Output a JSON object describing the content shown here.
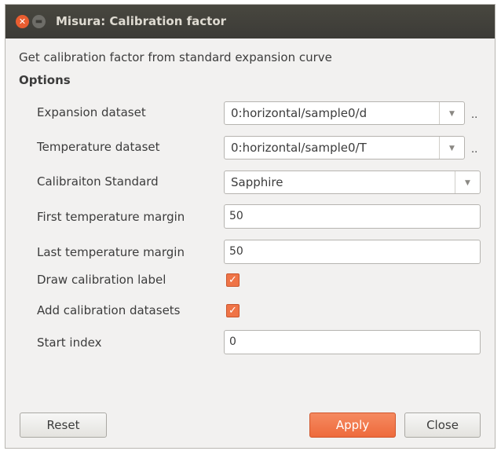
{
  "window": {
    "title": "Misura: Calibration factor"
  },
  "header": {
    "description": "Get calibration factor from standard expansion curve",
    "section": "Options"
  },
  "fields": {
    "expansion": {
      "label": "Expansion dataset",
      "value": "0:horizontal/sample0/d",
      "extra": ".."
    },
    "temperature": {
      "label": "Temperature dataset",
      "value": "0:horizontal/sample0/T",
      "extra": ".."
    },
    "standard": {
      "label": "Calibraiton Standard",
      "value": "Sapphire"
    },
    "first_margin": {
      "label": "First temperature margin",
      "value": "50"
    },
    "last_margin": {
      "label": "Last temperature margin",
      "value": "50"
    },
    "draw_label": {
      "label": "Draw calibration label",
      "checked": true
    },
    "add_datasets": {
      "label": "Add calibration datasets",
      "checked": true
    },
    "start_index": {
      "label": "Start index",
      "value": "0"
    }
  },
  "buttons": {
    "reset": "Reset",
    "apply": "Apply",
    "close": "Close"
  },
  "colors": {
    "accent": "#ef7447",
    "titlebar": "#3c3b37",
    "background": "#f2f1f0"
  }
}
